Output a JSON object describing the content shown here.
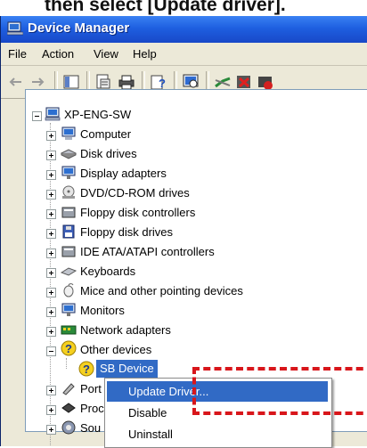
{
  "caption": "then select [Update driver].",
  "window": {
    "title": "Device Manager"
  },
  "menu": [
    "File",
    "Action",
    "View",
    "Help"
  ],
  "toolbar": {
    "buttons": [
      "back-icon",
      "forward-icon",
      "show-hide-tree-icon",
      "properties-icon",
      "print-icon",
      "help-icon",
      "scan-hardware-icon",
      "update-driver-icon",
      "uninstall-icon",
      "disable-icon"
    ]
  },
  "tree": {
    "root": "XP-ENG-SW",
    "categories": [
      "Computer",
      "Disk drives",
      "Display adapters",
      "DVD/CD-ROM drives",
      "Floppy disk controllers",
      "Floppy disk drives",
      "IDE ATA/ATAPI controllers",
      "Keyboards",
      "Mice and other pointing devices",
      "Monitors",
      "Network adapters",
      "Other devices"
    ],
    "selected_child": "SB Device",
    "partial": [
      "Port",
      "Proc",
      "Sou"
    ]
  },
  "context_menu": {
    "items": [
      "Update Driver...",
      "Disable",
      "Uninstall"
    ],
    "highlighted": "Update Driver..."
  },
  "colors": {
    "highlight": "#316ac5",
    "callout": "#d8161b",
    "titlebar": "#1e5fe0"
  }
}
